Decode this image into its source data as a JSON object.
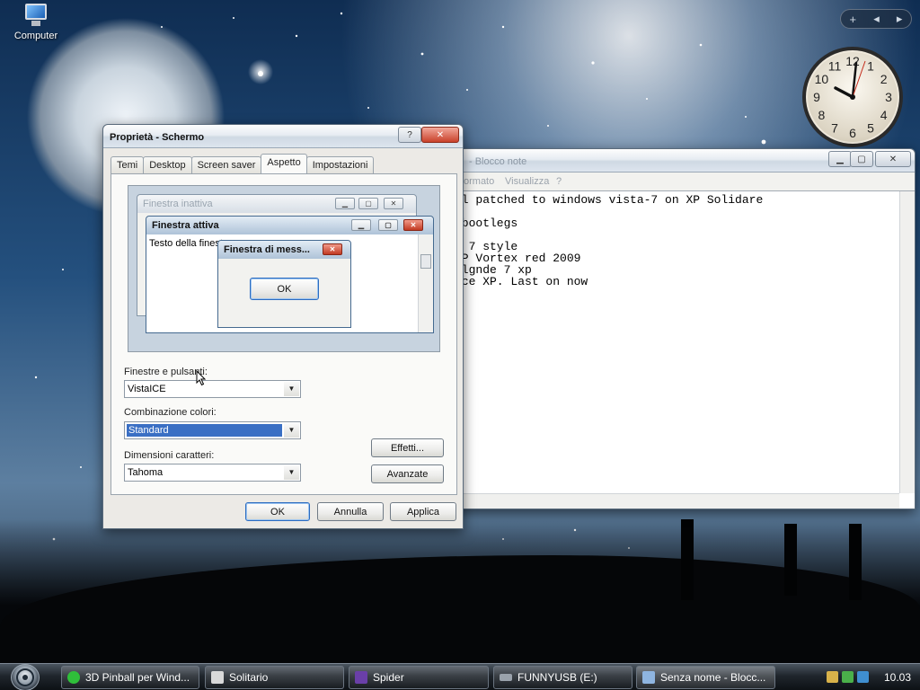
{
  "desktop": {
    "icon_label": "Computer"
  },
  "clock_gadget": {
    "numbers": [
      "12",
      "1",
      "2",
      "3",
      "4",
      "5",
      "6",
      "7",
      "8",
      "9",
      "10",
      "11"
    ],
    "time_shown": "10.03"
  },
  "gadget_bar": {
    "add_glyph": "+",
    "prev_glyph": "◂",
    "next_glyph": "▸"
  },
  "display_dialog": {
    "title": "Proprietà - Schermo",
    "help_glyph": "?",
    "close_glyph": "✕",
    "tabs": [
      {
        "label": "Temi",
        "active": false
      },
      {
        "label": "Desktop",
        "active": false
      },
      {
        "label": "Screen saver",
        "active": false
      },
      {
        "label": "Aspetto",
        "active": true
      },
      {
        "label": "Impostazioni",
        "active": false
      }
    ],
    "preview": {
      "inactive_window_title": "Finestra inattiva",
      "active_window_title": "Finestra attiva",
      "window_text": "Testo della finestra",
      "message_box_title": "Finestra di mess...",
      "message_box_ok": "OK"
    },
    "windows_buttons": {
      "label": "Finestre e pulsanti:",
      "value": "VistaICE"
    },
    "color_scheme": {
      "label": "Combinazione colori:",
      "value": "Standard"
    },
    "font_size": {
      "label": "Dimensioni caratteri:",
      "value": "Tahoma"
    },
    "effects_button": "Effetti...",
    "advanced_button": "Avanzate",
    "ok_button": "OK",
    "cancel_button": "Annulla",
    "apply_button": "Applica"
  },
  "notepad": {
    "title": "- Blocco note",
    "menu": [
      "ormato",
      "Visualizza",
      "?"
    ],
    "lines": [
      "ll patched to windows vista-7 on XP Solidare",
      "",
      " bootlegs",
      "",
      "P 7 style",
      "XP Vortex red 2009",
      "Elgnde 7 xp",
      "Ice XP. Last on now"
    ]
  },
  "taskbar": {
    "buttons": [
      {
        "label": "3D Pinball per Wind...",
        "icon_color": "#2fbf3a"
      },
      {
        "label": "Solitario",
        "icon_color": "#d9d9d9"
      },
      {
        "label": "Spider",
        "icon_color": "#6a3fa8"
      },
      {
        "label": "FUNNYUSB (E:)",
        "icon_color": "#9aa2ab"
      },
      {
        "label": "Senza nome - Blocc...",
        "icon_color": "#8fb5e0"
      }
    ],
    "clock": "10.03"
  }
}
